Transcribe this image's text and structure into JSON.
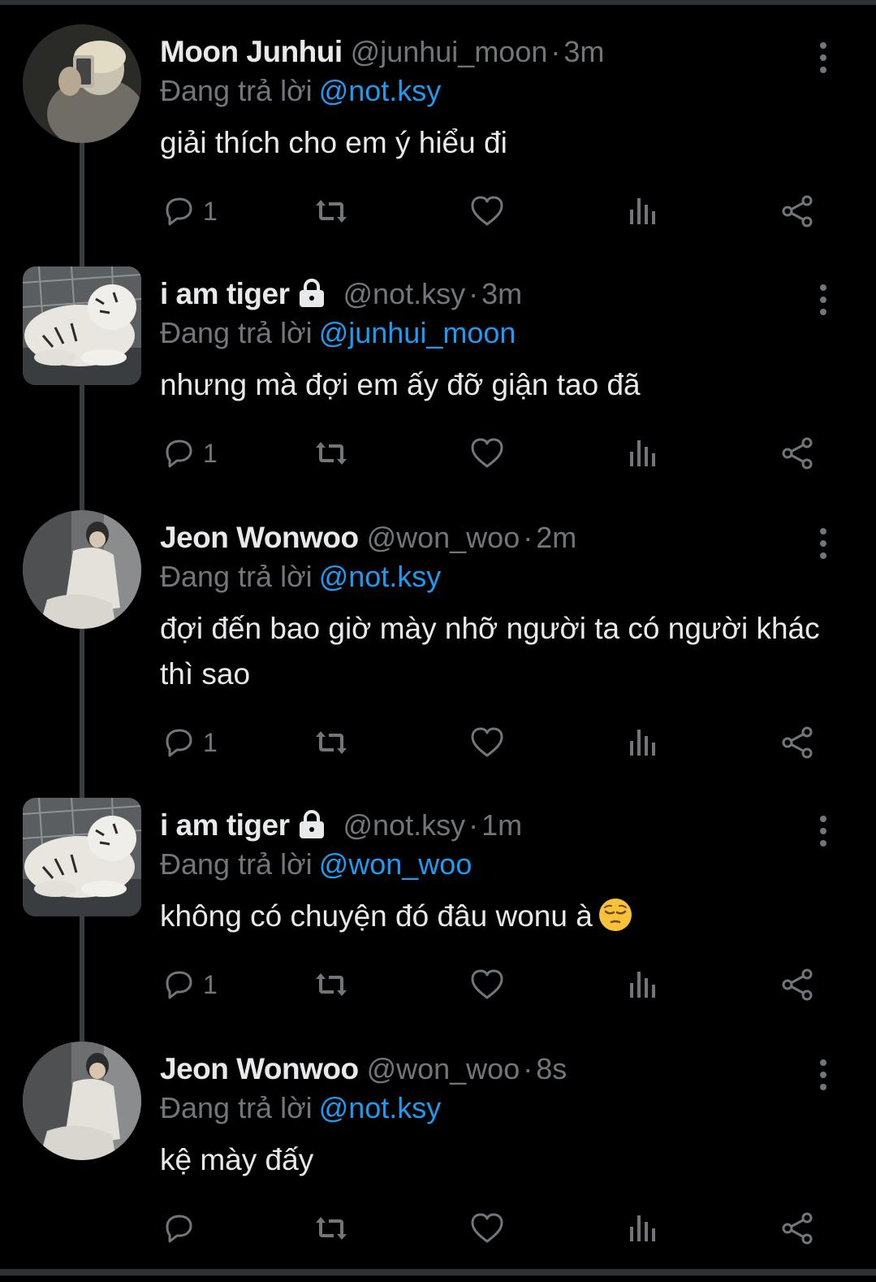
{
  "reply_prefix": "Đang trả lời",
  "colors": {
    "background": "#000000",
    "text": "#e7e9ea",
    "muted": "#71767b",
    "link": "#1d9bf0"
  },
  "tweets": [
    {
      "name": "Moon Junhui",
      "handle": "@junhui_moon",
      "time": "3m",
      "locked": false,
      "reply_to": "@not.ksy",
      "text": "giải thích cho em ý hiểu đi",
      "replies": "1",
      "avatar": "mirror-selfie"
    },
    {
      "name": "i am tiger",
      "handle": "@not.ksy",
      "time": "3m",
      "locked": true,
      "reply_to": "@junhui_moon",
      "text": "nhưng mà đợi em ấy đỡ giận tao đã",
      "replies": "1",
      "avatar": "white-tiger"
    },
    {
      "name": "Jeon Wonwoo",
      "handle": "@won_woo",
      "time": "2m",
      "locked": false,
      "reply_to": "@not.ksy",
      "text": "đợi đến bao giờ mày nhỡ người ta có người khác thì sao",
      "replies": "1",
      "avatar": "seated-person"
    },
    {
      "name": "i am tiger",
      "handle": "@not.ksy",
      "time": "1m",
      "locked": true,
      "reply_to": "@won_woo",
      "text": "không có chuyện đó đâu wonu à",
      "emoji": "pensive-face-emoji",
      "replies": "1",
      "avatar": "white-tiger"
    },
    {
      "name": "Jeon Wonwoo",
      "handle": "@won_woo",
      "time": "8s",
      "locked": false,
      "reply_to": "@not.ksy",
      "text": "kệ mày đấy",
      "replies": "",
      "avatar": "seated-person"
    }
  ]
}
